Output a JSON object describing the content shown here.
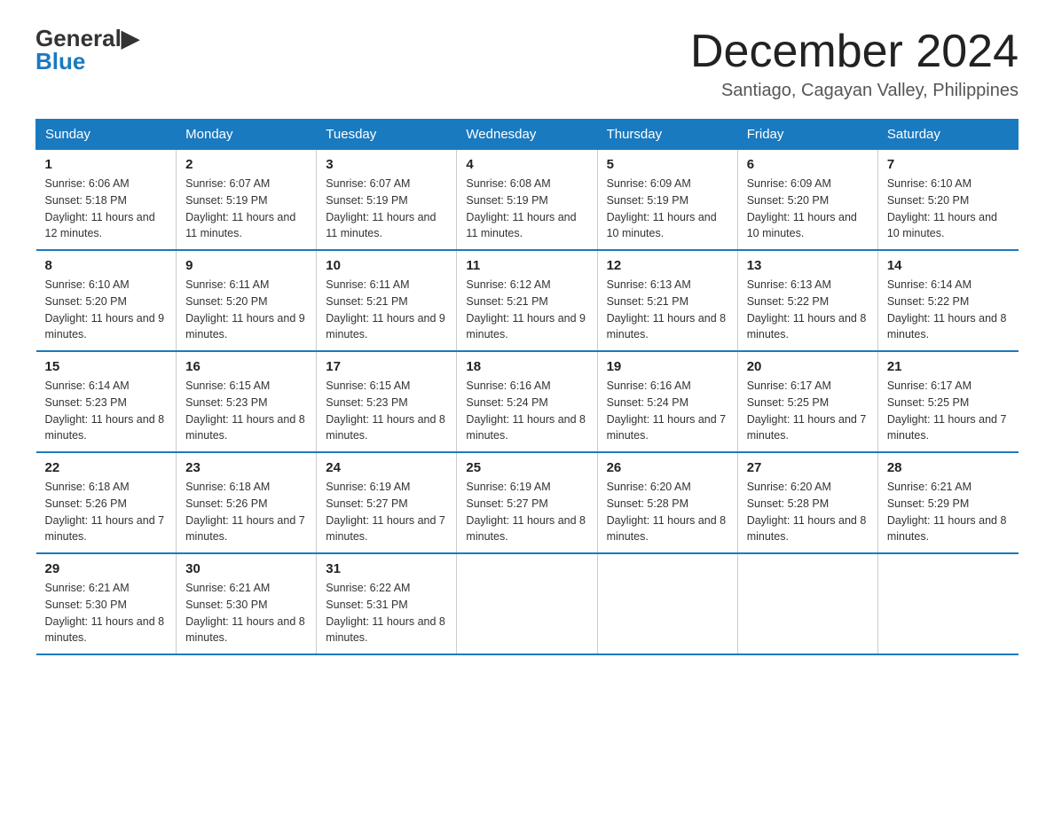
{
  "logo": {
    "general": "General",
    "blue": "Blue"
  },
  "title": "December 2024",
  "location": "Santiago, Cagayan Valley, Philippines",
  "days_of_week": [
    "Sunday",
    "Monday",
    "Tuesday",
    "Wednesday",
    "Thursday",
    "Friday",
    "Saturday"
  ],
  "weeks": [
    [
      {
        "day": "1",
        "sunrise": "6:06 AM",
        "sunset": "5:18 PM",
        "daylight": "11 hours and 12 minutes."
      },
      {
        "day": "2",
        "sunrise": "6:07 AM",
        "sunset": "5:19 PM",
        "daylight": "11 hours and 11 minutes."
      },
      {
        "day": "3",
        "sunrise": "6:07 AM",
        "sunset": "5:19 PM",
        "daylight": "11 hours and 11 minutes."
      },
      {
        "day": "4",
        "sunrise": "6:08 AM",
        "sunset": "5:19 PM",
        "daylight": "11 hours and 11 minutes."
      },
      {
        "day": "5",
        "sunrise": "6:09 AM",
        "sunset": "5:19 PM",
        "daylight": "11 hours and 10 minutes."
      },
      {
        "day": "6",
        "sunrise": "6:09 AM",
        "sunset": "5:20 PM",
        "daylight": "11 hours and 10 minutes."
      },
      {
        "day": "7",
        "sunrise": "6:10 AM",
        "sunset": "5:20 PM",
        "daylight": "11 hours and 10 minutes."
      }
    ],
    [
      {
        "day": "8",
        "sunrise": "6:10 AM",
        "sunset": "5:20 PM",
        "daylight": "11 hours and 9 minutes."
      },
      {
        "day": "9",
        "sunrise": "6:11 AM",
        "sunset": "5:20 PM",
        "daylight": "11 hours and 9 minutes."
      },
      {
        "day": "10",
        "sunrise": "6:11 AM",
        "sunset": "5:21 PM",
        "daylight": "11 hours and 9 minutes."
      },
      {
        "day": "11",
        "sunrise": "6:12 AM",
        "sunset": "5:21 PM",
        "daylight": "11 hours and 9 minutes."
      },
      {
        "day": "12",
        "sunrise": "6:13 AM",
        "sunset": "5:21 PM",
        "daylight": "11 hours and 8 minutes."
      },
      {
        "day": "13",
        "sunrise": "6:13 AM",
        "sunset": "5:22 PM",
        "daylight": "11 hours and 8 minutes."
      },
      {
        "day": "14",
        "sunrise": "6:14 AM",
        "sunset": "5:22 PM",
        "daylight": "11 hours and 8 minutes."
      }
    ],
    [
      {
        "day": "15",
        "sunrise": "6:14 AM",
        "sunset": "5:23 PM",
        "daylight": "11 hours and 8 minutes."
      },
      {
        "day": "16",
        "sunrise": "6:15 AM",
        "sunset": "5:23 PM",
        "daylight": "11 hours and 8 minutes."
      },
      {
        "day": "17",
        "sunrise": "6:15 AM",
        "sunset": "5:23 PM",
        "daylight": "11 hours and 8 minutes."
      },
      {
        "day": "18",
        "sunrise": "6:16 AM",
        "sunset": "5:24 PM",
        "daylight": "11 hours and 8 minutes."
      },
      {
        "day": "19",
        "sunrise": "6:16 AM",
        "sunset": "5:24 PM",
        "daylight": "11 hours and 7 minutes."
      },
      {
        "day": "20",
        "sunrise": "6:17 AM",
        "sunset": "5:25 PM",
        "daylight": "11 hours and 7 minutes."
      },
      {
        "day": "21",
        "sunrise": "6:17 AM",
        "sunset": "5:25 PM",
        "daylight": "11 hours and 7 minutes."
      }
    ],
    [
      {
        "day": "22",
        "sunrise": "6:18 AM",
        "sunset": "5:26 PM",
        "daylight": "11 hours and 7 minutes."
      },
      {
        "day": "23",
        "sunrise": "6:18 AM",
        "sunset": "5:26 PM",
        "daylight": "11 hours and 7 minutes."
      },
      {
        "day": "24",
        "sunrise": "6:19 AM",
        "sunset": "5:27 PM",
        "daylight": "11 hours and 7 minutes."
      },
      {
        "day": "25",
        "sunrise": "6:19 AM",
        "sunset": "5:27 PM",
        "daylight": "11 hours and 8 minutes."
      },
      {
        "day": "26",
        "sunrise": "6:20 AM",
        "sunset": "5:28 PM",
        "daylight": "11 hours and 8 minutes."
      },
      {
        "day": "27",
        "sunrise": "6:20 AM",
        "sunset": "5:28 PM",
        "daylight": "11 hours and 8 minutes."
      },
      {
        "day": "28",
        "sunrise": "6:21 AM",
        "sunset": "5:29 PM",
        "daylight": "11 hours and 8 minutes."
      }
    ],
    [
      {
        "day": "29",
        "sunrise": "6:21 AM",
        "sunset": "5:30 PM",
        "daylight": "11 hours and 8 minutes."
      },
      {
        "day": "30",
        "sunrise": "6:21 AM",
        "sunset": "5:30 PM",
        "daylight": "11 hours and 8 minutes."
      },
      {
        "day": "31",
        "sunrise": "6:22 AM",
        "sunset": "5:31 PM",
        "daylight": "11 hours and 8 minutes."
      },
      null,
      null,
      null,
      null
    ]
  ]
}
